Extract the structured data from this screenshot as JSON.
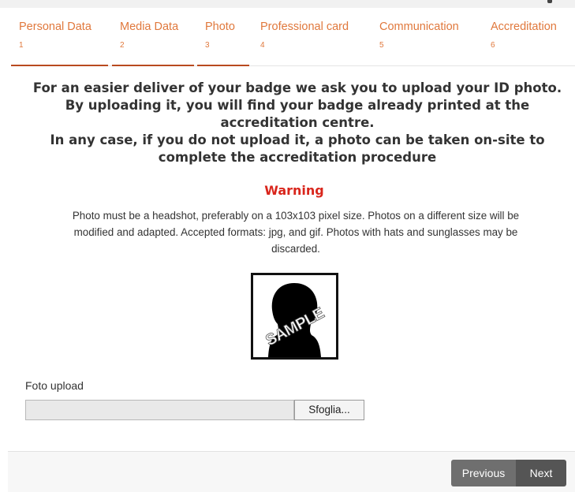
{
  "tabs": [
    {
      "label": "Personal Data",
      "step": "1"
    },
    {
      "label": "Media Data",
      "step": "2"
    },
    {
      "label": "Photo",
      "step": "3"
    },
    {
      "label": "Professional card",
      "step": "4"
    },
    {
      "label": "Communication",
      "step": "5"
    },
    {
      "label": "Accreditation",
      "step": "6"
    }
  ],
  "intro": {
    "line1": "For an easier deliver of your badge we ask you to upload your ID photo.",
    "line2": "By uploading it, you will find your badge already printed at the",
    "line3": "accreditation centre.",
    "line4": "In any case, if you do not upload it, a photo can be taken on-site to",
    "line5": "complete the accreditation procedure"
  },
  "warning": {
    "title": "Warning",
    "line1": "Photo must be a headshot, preferably on a 103x103 pixel size. Photos on a different size will be",
    "line2": "modified and adapted. Accepted formats: jpg, and gif. Photos with hats and sunglasses may be",
    "line3": "discarded."
  },
  "sample": {
    "watermark": "SAMPLE"
  },
  "upload": {
    "label": "Foto upload",
    "value": "",
    "browse_label": "Sfoglia..."
  },
  "nav": {
    "previous_label": "Previous",
    "next_label": "Next"
  },
  "colors": {
    "tab_text": "#e0783c",
    "tab_done_underline": "#b94a1f",
    "warning": "#d9261c",
    "button": "#5e5e5e"
  }
}
